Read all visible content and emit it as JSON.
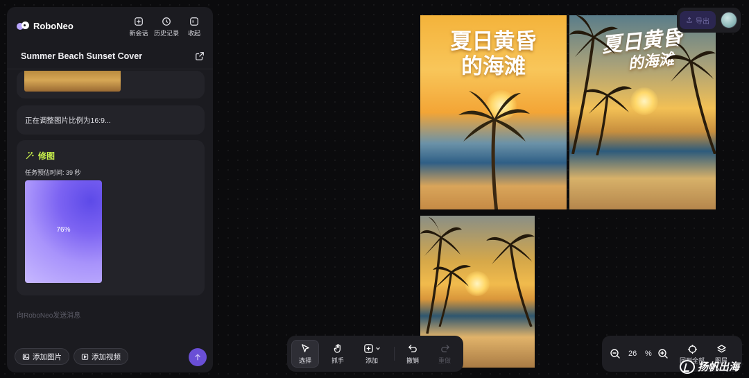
{
  "app": {
    "name": "RoboNeo"
  },
  "sidebar": {
    "actions": [
      {
        "label": "新会话",
        "icon": "new-chat-icon"
      },
      {
        "label": "历史记录",
        "icon": "history-icon"
      },
      {
        "label": "收起",
        "icon": "collapse-icon"
      }
    ],
    "session_title": "Summer Beach Sunset Cover",
    "status_message": "正在调整图片比例为16:9...",
    "edit_task": {
      "title": "修图",
      "eta_label": "任务预估时间:",
      "eta_value": "39 秒",
      "progress_text": "76%",
      "progress": 0.76
    },
    "input_placeholder": "向RoboNeo发送消息",
    "add_image_label": "添加图片",
    "add_video_label": "添加视频"
  },
  "canvas": {
    "images": [
      {
        "title_line1": "夏日黄昏",
        "title_line2": "的海滩"
      },
      {
        "title_line1": "夏日黄昏",
        "title_line2": "的海滩"
      },
      {
        "title_line1": "",
        "title_line2": ""
      }
    ]
  },
  "header": {
    "export_label": "导出"
  },
  "toolbar": {
    "select_label": "选择",
    "hand_label": "抓手",
    "add_label": "添加",
    "undo_label": "撤销",
    "redo_label": "重做"
  },
  "zoom": {
    "value": "26",
    "unit": "%",
    "fit_label": "回到全部",
    "layers_label": "图层"
  },
  "watermark": {
    "text": "扬帆出海"
  },
  "colors": {
    "accent": "#c8f04c",
    "brand": "#6a4fd6",
    "background": "#0b0b0d"
  }
}
